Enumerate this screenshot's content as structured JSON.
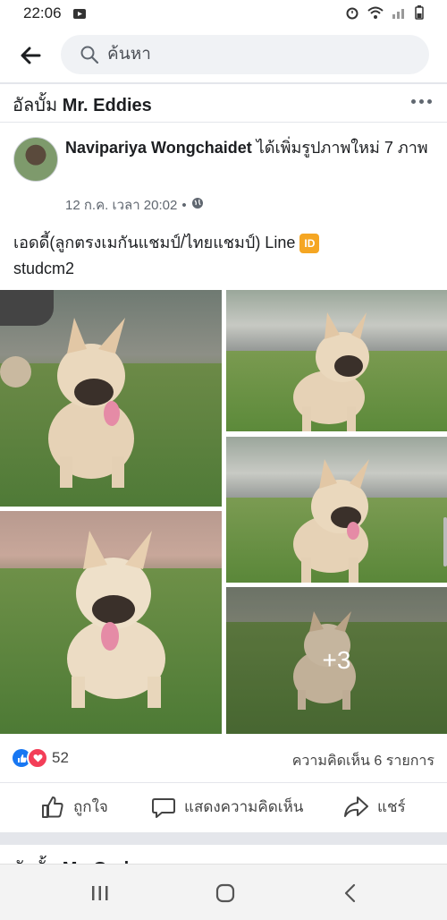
{
  "status": {
    "time": "22:06"
  },
  "search": {
    "placeholder": "ค้นหา"
  },
  "album": {
    "prefix": "อัลบั้ม",
    "name": "Mr. Eddies"
  },
  "post": {
    "author": "Navipariya Wongchaidet",
    "action_text": "ได้เพิ่มรูปภาพใหม่ 7 ภาพ",
    "timestamp": "12 ก.ค. เวลา 20:02",
    "separator": "•",
    "text_main": "เอดดี้(ลูกตรงเมกันแชมป์/ไทยแชมป์) Line",
    "badge": "ID",
    "text_line2": "studcm2",
    "more_photos": "+3"
  },
  "reactions": {
    "count": "52"
  },
  "comments": {
    "label": "ความคิดเห็น 6 รายการ"
  },
  "actions": {
    "like": "ถูกใจ",
    "comment": "แสดงความคิดเห็น",
    "share": "แชร์"
  },
  "next_album": {
    "prefix": "อัลบั้ม",
    "name": "Mr. God"
  },
  "colors": {
    "like_blue": "#1877f2",
    "love_red": "#f33e58",
    "badge_orange": "#f5a623",
    "search_bg": "#f0f2f5"
  },
  "icons": [
    "back-arrow-icon",
    "search-icon",
    "more-icon",
    "globe-icon",
    "like-icon",
    "comment-icon",
    "share-icon",
    "recents-icon",
    "home-icon",
    "back-nav-icon"
  ]
}
